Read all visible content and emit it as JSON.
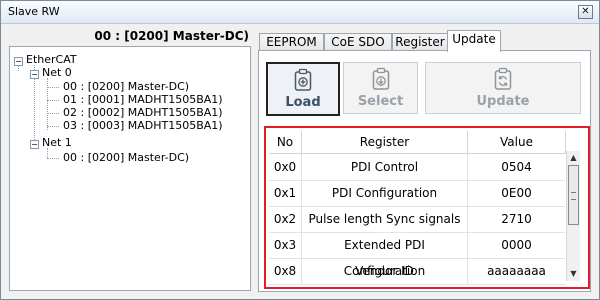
{
  "window": {
    "title": "Slave RW",
    "close_glyph": "✕"
  },
  "device_title": "00 : [0200] Master-DC)",
  "tree": {
    "root": "EtherCAT",
    "nets": [
      {
        "label": "Net 0",
        "items": [
          "00 : [0200] Master-DC)",
          "01 : [0001] MADHT1505BA1)",
          "02 : [0002] MADHT1505BA1)",
          "03 : [0003] MADHT1505BA1)"
        ]
      },
      {
        "label": "Net 1",
        "items": [
          "00 : [0200] Master-DC)"
        ]
      }
    ]
  },
  "tabs": [
    "EEPROM",
    "CoE SDO",
    "Register",
    "Update"
  ],
  "active_tab": "Update",
  "toolbar": {
    "load": {
      "label": "Load",
      "icon": "load-icon"
    },
    "select": {
      "label": "Select",
      "icon": "select-icon"
    },
    "update": {
      "label": "Update",
      "icon": "update-icon"
    }
  },
  "table": {
    "columns": [
      "No",
      "Register",
      "Value"
    ],
    "rows": [
      {
        "no": "0x0",
        "register": "PDI Control",
        "value": "0504"
      },
      {
        "no": "0x1",
        "register": "PDI Configuration",
        "value": "0E00"
      },
      {
        "no": "0x2",
        "register": "Pulse length Sync signals",
        "value": "2710"
      },
      {
        "no": "0x3",
        "register": "Extended PDI Configuration",
        "value": "0000"
      },
      {
        "no": "0x8",
        "register": "Vendor ID",
        "value": "aaaaaaaa"
      }
    ]
  },
  "colors": {
    "highlight_border": "#e21d25",
    "button_active": "#3b4f66"
  }
}
